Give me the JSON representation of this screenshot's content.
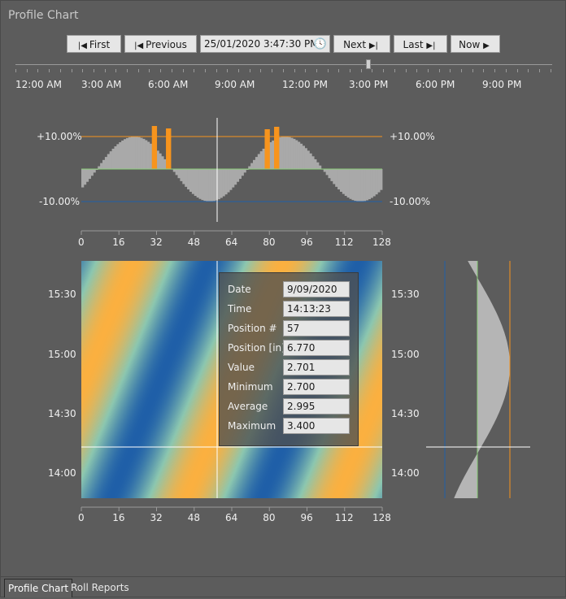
{
  "window": {
    "title": "Profile Chart"
  },
  "toolbar": {
    "first_label": "First",
    "previous_label": "Previous",
    "datetime_value": "25/01/2020 3:47:30 PM",
    "next_label": "Next",
    "last_label": "Last",
    "now_label": "Now"
  },
  "timeline": {
    "labels": [
      "12:00 AM",
      "3:00 AM",
      "6:00 AM",
      "9:00 AM",
      "12:00 PM",
      "3:00 PM",
      "6:00 PM",
      "9:00 PM"
    ],
    "thumb_position_fraction": 0.655
  },
  "profile": {
    "upper_limit_left": "+10.00%",
    "upper_limit_right": "+10.00%",
    "lower_limit_left": "-10.00%",
    "lower_limit_right": "-10.00%",
    "x_ticks": [
      "0",
      "16",
      "32",
      "48",
      "64",
      "80",
      "96",
      "112",
      "128"
    ],
    "colors": {
      "limit_upper": "#f7941d",
      "limit_lower": "#1f5fa8",
      "centerline": "#8cd07a",
      "bar": "#a9a9a9",
      "exceed": "#f7941d"
    }
  },
  "heatmap": {
    "y_ticks": [
      "15:30",
      "15:00",
      "14:30",
      "14:00"
    ],
    "x_ticks": [
      "0",
      "16",
      "32",
      "48",
      "64",
      "80",
      "96",
      "112",
      "128"
    ],
    "colors": {
      "low": "#1f5fa8",
      "mid": "#8cc7b0",
      "high": "#fbb040"
    }
  },
  "tooltip": {
    "rows": [
      {
        "label": "Date",
        "value": "9/09/2020"
      },
      {
        "label": "Time",
        "value": "14:13:23"
      },
      {
        "label": "Position #",
        "value": "57"
      },
      {
        "label": "Position [in]",
        "value": "6.770"
      },
      {
        "label": "Value",
        "value": "2.701"
      },
      {
        "label": "Minimum",
        "value": "2.700"
      },
      {
        "label": "Average",
        "value": "2.995"
      },
      {
        "label": "Maximum",
        "value": "3.400"
      }
    ]
  },
  "tabs": [
    {
      "label": "Profile Chart",
      "active": true
    },
    {
      "label": "Roll Reports",
      "active": false
    }
  ]
}
